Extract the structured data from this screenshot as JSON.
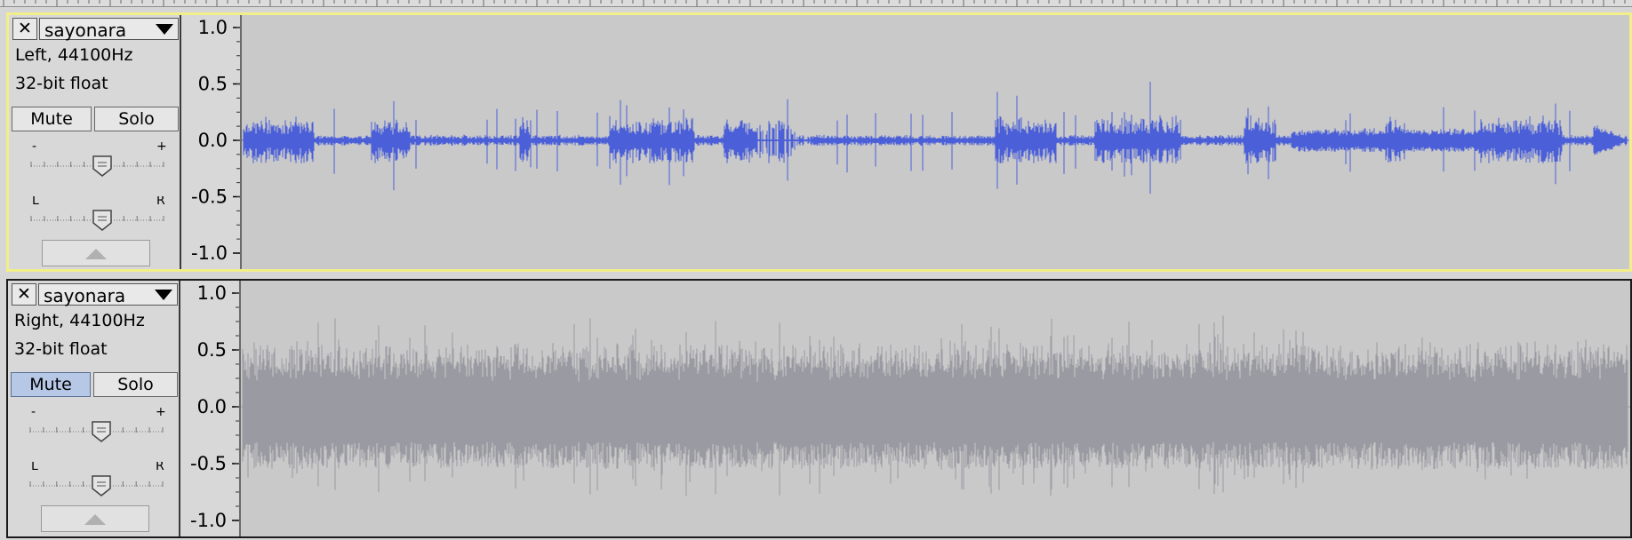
{
  "tracks": [
    {
      "name": "sayonara",
      "channel_info": "Left, 44100Hz",
      "format_info": "32-bit float",
      "mute_label": "Mute",
      "solo_label": "Solo",
      "mute_active": false,
      "selected": true,
      "gain_ticks": [
        "-",
        "+"
      ],
      "pan_ticks": [
        "L",
        "R"
      ],
      "axis_labels": [
        "1.0",
        "0.5",
        "0.0",
        "-0.5",
        "-1.0"
      ],
      "waveform_color": "#4a5fd8"
    },
    {
      "name": "sayonara",
      "channel_info": "Right, 44100Hz",
      "format_info": "32-bit float",
      "mute_label": "Mute",
      "solo_label": "Solo",
      "mute_active": true,
      "selected": false,
      "gain_ticks": [
        "-",
        "+"
      ],
      "pan_ticks": [
        "L",
        "R"
      ],
      "axis_labels": [
        "1.0",
        "0.5",
        "0.0",
        "-0.5",
        "-1.0"
      ],
      "waveform_color": "#9a9ba2"
    }
  ],
  "icons": [
    "close-icon",
    "chevron-down-icon",
    "collapse-arrow-icon"
  ]
}
